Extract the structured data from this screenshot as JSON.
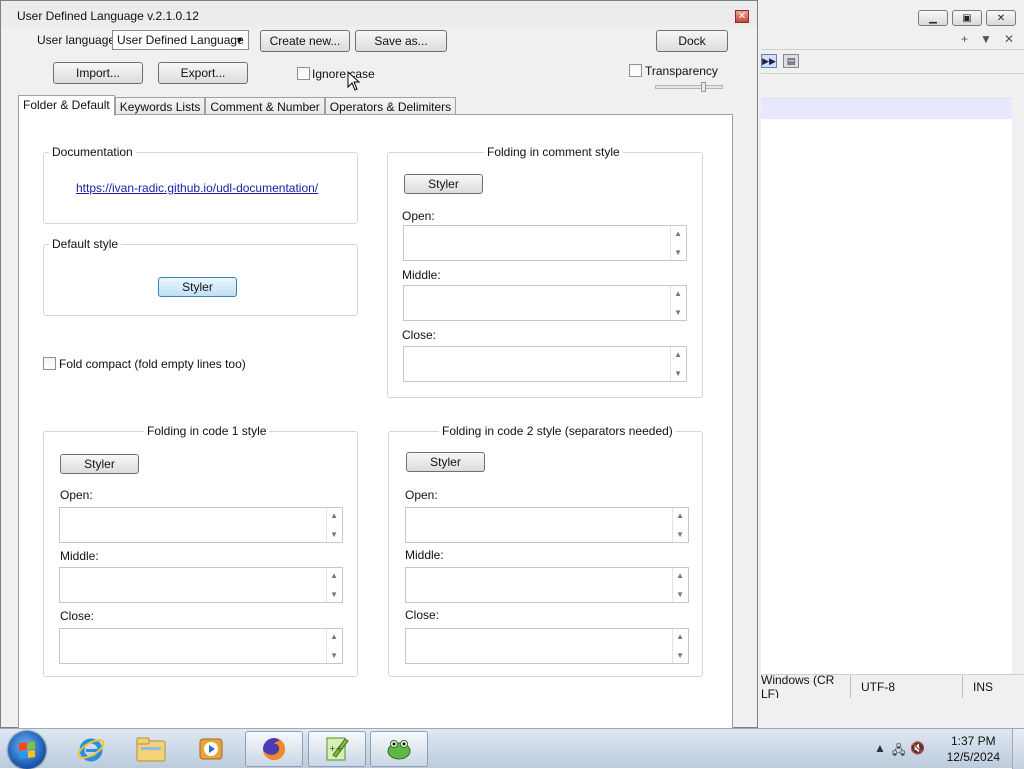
{
  "background_window": {
    "status": {
      "eol": "Windows (CR LF)",
      "encoding": "UTF-8",
      "mode": "INS"
    },
    "tab_controls": {
      "add": "+",
      "list": "▼",
      "close": "✕"
    }
  },
  "dialog": {
    "title": "User Defined Language v.2.1.0.12",
    "user_language_label": "User language:",
    "user_language_value": "User Defined Language",
    "buttons": {
      "create_new": "Create new...",
      "save_as": "Save as...",
      "dock": "Dock",
      "import": "Import...",
      "export": "Export..."
    },
    "ignore_case_label": "Ignore case",
    "transparency_label": "Transparency",
    "tabs": [
      "Folder & Default",
      "Keywords Lists",
      "Comment & Number",
      "Operators & Delimiters"
    ],
    "documentation": {
      "label": "Documentation",
      "url": "https://ivan-radic.github.io/udl-documentation/"
    },
    "default_style": {
      "label": "Default style",
      "styler": "Styler"
    },
    "fold_compact_label": "Fold compact (fold empty lines too)",
    "folding_comment": {
      "label": "Folding in comment style",
      "styler": "Styler",
      "open": "Open:",
      "middle": "Middle:",
      "close": "Close:"
    },
    "folding_code1": {
      "label": "Folding in code 1 style",
      "styler": "Styler",
      "open": "Open:",
      "middle": "Middle:",
      "close": "Close:"
    },
    "folding_code2": {
      "label": "Folding in code 2 style (separators needed)",
      "styler": "Styler",
      "open": "Open:",
      "middle": "Middle:",
      "close": "Close:"
    }
  },
  "taskbar": {
    "time": "1:37 PM",
    "date": "12/5/2024"
  }
}
